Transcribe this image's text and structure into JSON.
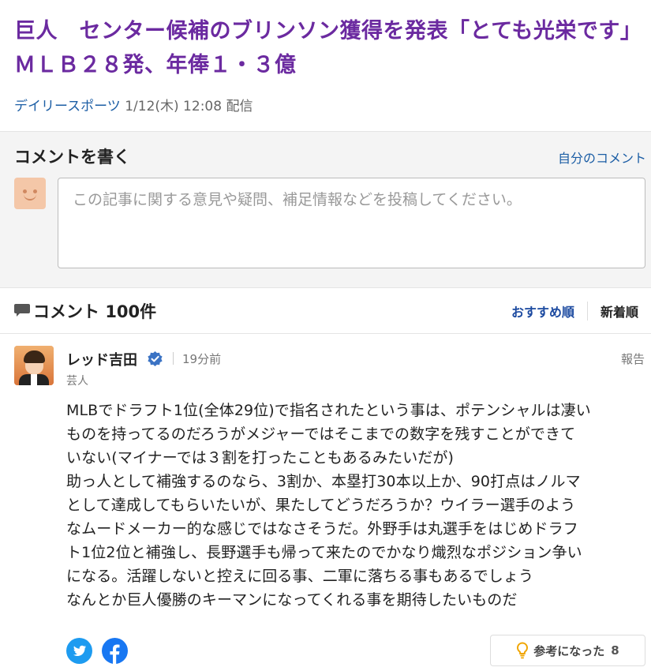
{
  "article": {
    "title": "巨人　センター候補のブリンソン獲得を発表「とても光栄です」ＭＬＢ２８発、年俸１・３億",
    "source": "デイリースポーツ",
    "date": "1/12(木) 12:08",
    "published_label": "配信"
  },
  "write_comment": {
    "title": "コメントを書く",
    "my_comments_link": "自分のコメント",
    "placeholder": "この記事に関する意見や疑問、補足情報などを投稿してください。"
  },
  "comments_header": {
    "label": "コメント",
    "count": "100件",
    "sort_options": [
      "おすすめ順",
      "新着順"
    ],
    "active_sort": "おすすめ順"
  },
  "comment": {
    "author": "レッド吉田",
    "time_ago": "19分前",
    "role": "芸人",
    "report_label": "報告",
    "body_lines": [
      "MLBでドラフト1位(全体29位)で指名されたという事は、ポテンシャルは凄い",
      "ものを持ってるのだろうがメジャーではそこまでの数字を残すことができて",
      "いない(マイナーでは３割を打ったこともあるみたいだが)",
      "助っ人として補強するのなら、3割か、本塁打30本以上か、90打点はノルマ",
      "として達成してもらいたいが、果たしてどうだろうか？ウイラー選手のよう",
      "なムードメーカー的な感じではなさそうだ。外野手は丸選手をはじめドラフ",
      "ト1位2位と補強し、長野選手も帰って来たのでかなり熾烈なポジション争い",
      "になる。活躍しないと控えに回る事、二軍に落ちる事もあるでしょう",
      "なんとか巨人優勝のキーマンになってくれる事を期待したいものだ"
    ],
    "helpful_label": "参考になった",
    "helpful_count": "8"
  },
  "colors": {
    "title_purple": "#6b2aa0",
    "link_blue": "#1c5ea5",
    "twitter": "#1d9bf0",
    "facebook": "#1877f2"
  },
  "icons": [
    "smile-avatar-icon",
    "comment-bubble-icon",
    "verified-badge-icon",
    "twitter-icon",
    "facebook-icon",
    "lightbulb-icon"
  ]
}
